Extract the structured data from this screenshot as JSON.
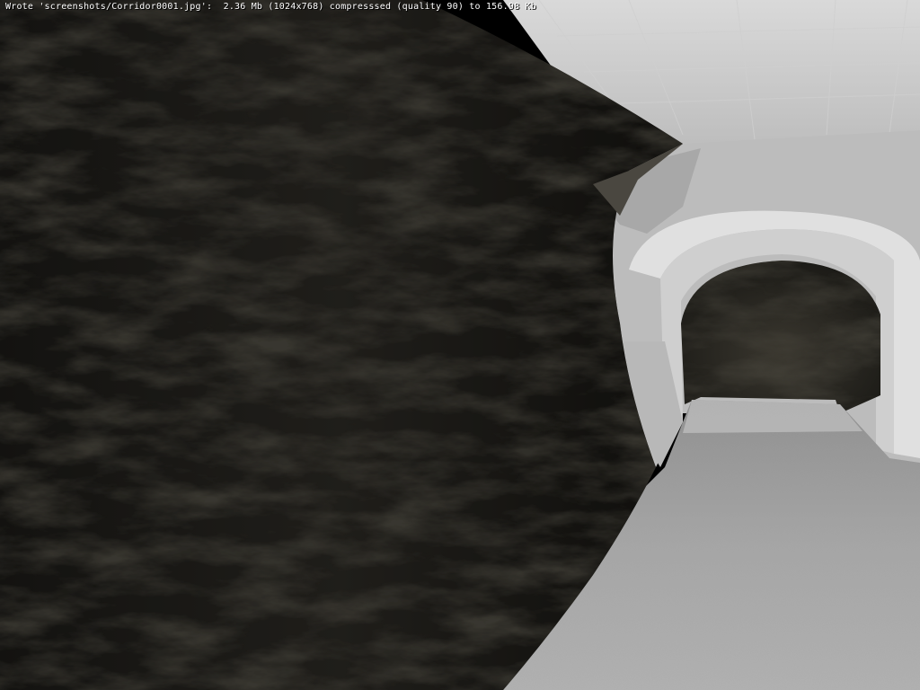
{
  "console": {
    "message": "Wrote 'screenshots/Corridor0001.jpg':  2.36 Mb (1024x768) compresssed (quality 90) to 156.98 Kb"
  }
}
